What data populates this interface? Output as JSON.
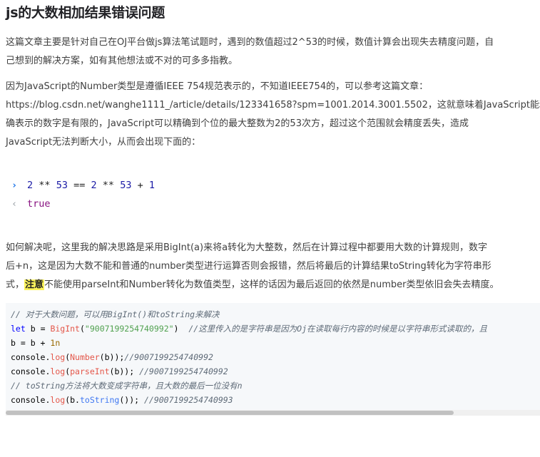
{
  "article": {
    "title": "js的大数相加结果错误问题",
    "intro": [
      "这篇文章主要是针对自己在OJ平台做js算法笔试题时，遇到的数值超过2^53的时候，数值计算会出现失去精度问题，自",
      "己想到的解决方案，如有其他想法或不对的可多多指教。"
    ],
    "explain": [
      "因为JavaScript的Number类型是遵循IEEE 754规范表示的，不知道IEEE754的，可以参考这篇文章：",
      "https://blog.csdn.net/wanghe1111_/article/details/123341658?spm=1001.2014.3001.5502，这就意味着JavaScript能精",
      "确表示的数字是有限的，JavaScript可以精确到个位的最大整数为2的53次方，超过这个范围就会精度丢失，造成",
      "JavaScript无法判断大小，从而会出现下面的："
    ],
    "console": {
      "prompt_icon": "chevron-right-icon",
      "result_icon": "arrow-left-icon",
      "tokens": [
        "2",
        "**",
        "53",
        "==",
        "2",
        "**",
        "53",
        "+",
        "1"
      ],
      "result": "true"
    },
    "solution": {
      "line1": "如何解决呢，这里我的解决思路是采用BigInt(a)来将a转化为大整数，然后在计算过程中都要用大数的计算规则，数字",
      "line2": "后+n，这是因为大数不能和普通的number类型进行运算否则会报错，然后将最后的计算结果toString转化为字符串形",
      "line3_before": "式，",
      "highlight": "注意",
      "line3_after": "不能使用parseInt和Number转化为数值类型，这样的话因为最后返回的依然是number类型依旧会失去精度。"
    },
    "code": {
      "comment1": "// 对于大数问题，可以用BigInt()和toString来解决",
      "let_kw": "let",
      "var_b": "b",
      "eq": " = ",
      "bigint_fn": "BigInt",
      "bigint_arg": "\"9007199254740992\"",
      "line2_comment": "//这里传入的是字符串是因为Oj在读取每行内容的时候是以字符串形式读取的，且",
      "line3": "b = b + ",
      "line3_num": "1n",
      "console_obj": "console",
      "log_fn": "log",
      "number_fn": "Number",
      "parseint_fn": "parseInt",
      "tostring_fn": "toString",
      "comment_num1": "//9007199254740992",
      "comment_num2": "//9007199254740992",
      "comment_tostring": "// toString方法将大数变成字符串，且大数的最后一位没有n",
      "comment_num3": "//9007199254740993"
    }
  }
}
